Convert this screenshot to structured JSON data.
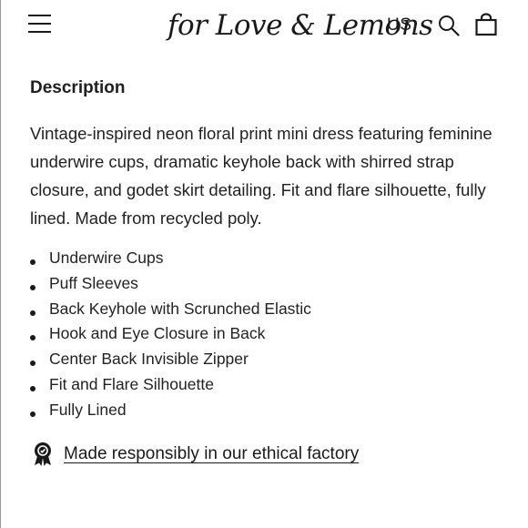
{
  "header": {
    "menu_icon": "hamburger-menu-icon",
    "logo": "for Love & Lemons",
    "region": "US",
    "search_icon": "search-icon",
    "bag_icon": "shopping-bag-icon"
  },
  "description": {
    "title": "Description",
    "body": "Vintage-inspired neon floral print mini dress featuring feminine underwire cups, dramatic keyhole back with shirred strap closure, and godet skirt detailing. Fit and flare silhouette, fully lined. Made from recycled poly.",
    "features": [
      "Underwire Cups",
      "Puff Sleeves",
      "Back Keyhole with Scrunched Elastic",
      "Hook and Eye Closure in Back",
      "Center Back Invisible Zipper",
      "Fit and Flare Silhouette",
      "Fully Lined"
    ]
  },
  "ethical": {
    "icon": "award-ribbon-icon",
    "link": "Made responsibly in our ethical factory"
  }
}
